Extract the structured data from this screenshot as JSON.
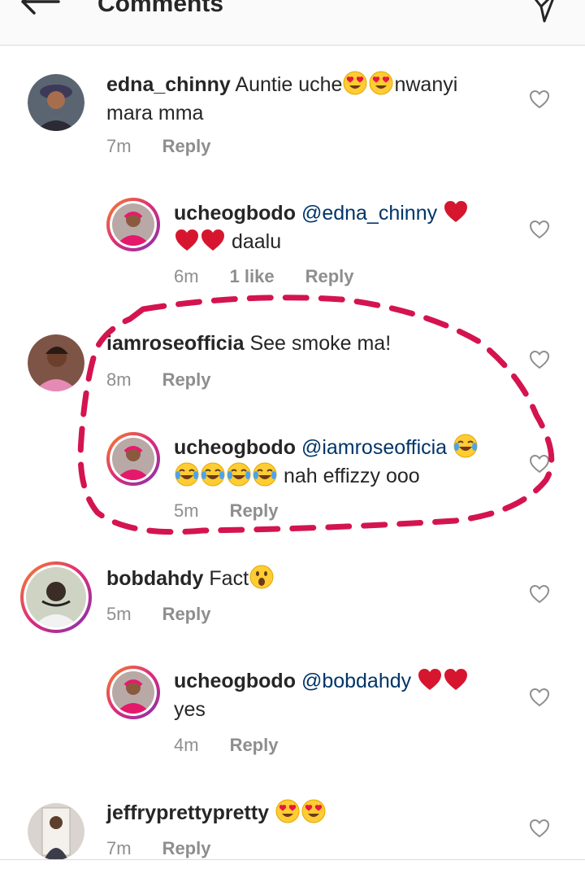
{
  "header": {
    "title": "Comments"
  },
  "comments": [
    {
      "username": "edna_chinny",
      "text_a": "Auntie uche",
      "text_b": "nwanyi mara mma",
      "time": "7m",
      "reply": "Reply",
      "replies": [
        {
          "username": "ucheogbodo",
          "mention": "@edna_chinny",
          "text": "daalu",
          "time": "6m",
          "likes": "1 like",
          "reply": "Reply"
        }
      ]
    },
    {
      "username": "iamroseofficia",
      "text": "See smoke ma!",
      "time": "8m",
      "reply": "Reply",
      "replies": [
        {
          "username": "ucheogbodo",
          "mention": "@iamroseofficia",
          "text": "nah effizzy ooo",
          "time": "5m",
          "reply": "Reply"
        }
      ]
    },
    {
      "username": "bobdahdy",
      "text": "Fact",
      "time": "5m",
      "reply": "Reply",
      "replies": [
        {
          "username": "ucheogbodo",
          "mention": "@bobdahdy",
          "text": "yes",
          "time": "4m",
          "reply": "Reply"
        }
      ]
    },
    {
      "username": "jeffryprettypretty",
      "time": "7m",
      "reply": "Reply"
    }
  ],
  "colors": {
    "mention": "#003569",
    "annotation": "#d4144f",
    "ring": "#dd2a7b"
  }
}
